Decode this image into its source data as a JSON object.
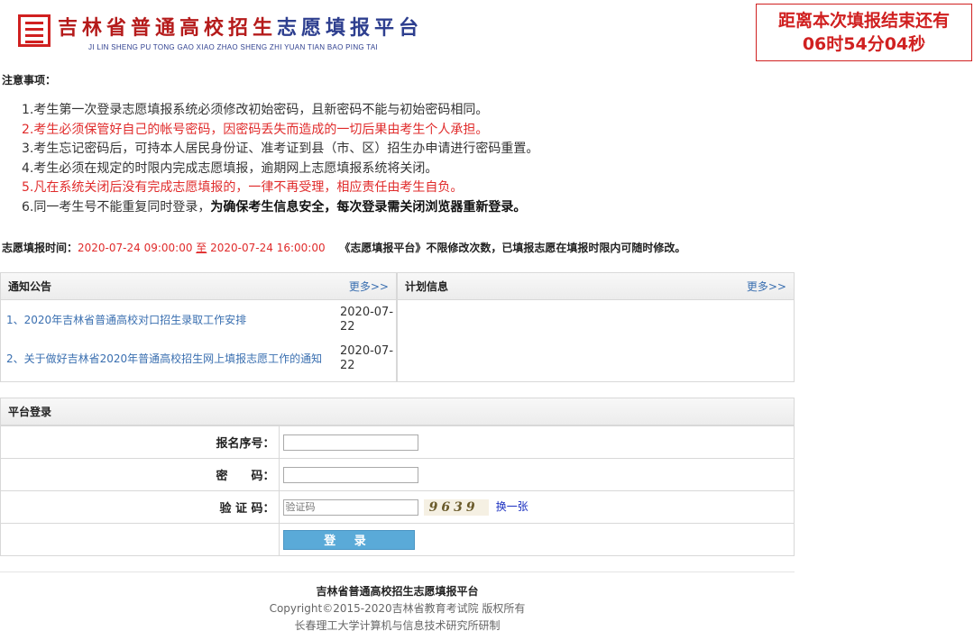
{
  "header": {
    "logo_title_red": "吉林省普通高校招生",
    "logo_title_blue": "志愿填报平台",
    "logo_subtitle": "JI LIN SHENG PU TONG GAO XIAO ZHAO SHENG  ZHI YUAN TIAN BAO PING TAI",
    "countdown_line1": "距离本次填报结束还有",
    "countdown_line2": "06时54分04秒"
  },
  "notes": {
    "title": "注意事项：",
    "items": [
      "1.考生第一次登录志愿填报系统必须修改初始密码，且新密码不能与初始密码相同。",
      "2.考生必须保管好自己的帐号密码，因密码丢失而造成的一切后果由考生个人承担。",
      "3.考生忘记密码后，可持本人居民身份证、准考证到县（市、区）招生办申请进行密码重置。",
      "4.考生必须在规定的时限内完成志愿填报，逾期网上志愿填报系统将关闭。",
      "5.凡在系统关闭后没有完成志愿填报的，一律不再受理，相应责任由考生自负。"
    ],
    "item6_normal": "6.同一考生号不能重复同时登录，",
    "item6_bold": "为确保考生信息安全，每次登录需关闭浏览器重新登录。"
  },
  "schedule": {
    "label": "志愿填报时间：",
    "start": "2020-07-24 09:00:00",
    "sep": "至",
    "end": "2020-07-24 16:00:00",
    "note": "《志愿填报平台》不限修改次数，已填报志愿在填报时限内可随时修改。"
  },
  "notice_panel": {
    "title": "通知公告",
    "more": "更多>>",
    "items": [
      {
        "title": "1、2020年吉林省普通高校对口招生录取工作安排",
        "date": "2020-07-22"
      },
      {
        "title": "2、关于做好吉林省2020年普通高校招生网上填报志愿工作的通知",
        "date": "2020-07-22"
      }
    ]
  },
  "plan_panel": {
    "title": "计划信息",
    "more": "更多>>"
  },
  "login": {
    "title": "平台登录",
    "reg_label": "报名序号：",
    "pwd_label": "密　　码：",
    "captcha_label": "验 证 码：",
    "captcha_placeholder": "验证码",
    "captcha_text": "9639",
    "refresh": "换一张",
    "submit": "登 录"
  },
  "footer": {
    "line1": "吉林省普通高校招生志愿填报平台",
    "line2": "Copyright©2015-2020吉林省教育考试院 版权所有",
    "line3": "长春理工大学计算机与信息技术研究所研制"
  },
  "colors": {
    "accent_red": "#d02020",
    "link_blue": "#3a6fb0",
    "button_blue": "#5aaad8"
  }
}
